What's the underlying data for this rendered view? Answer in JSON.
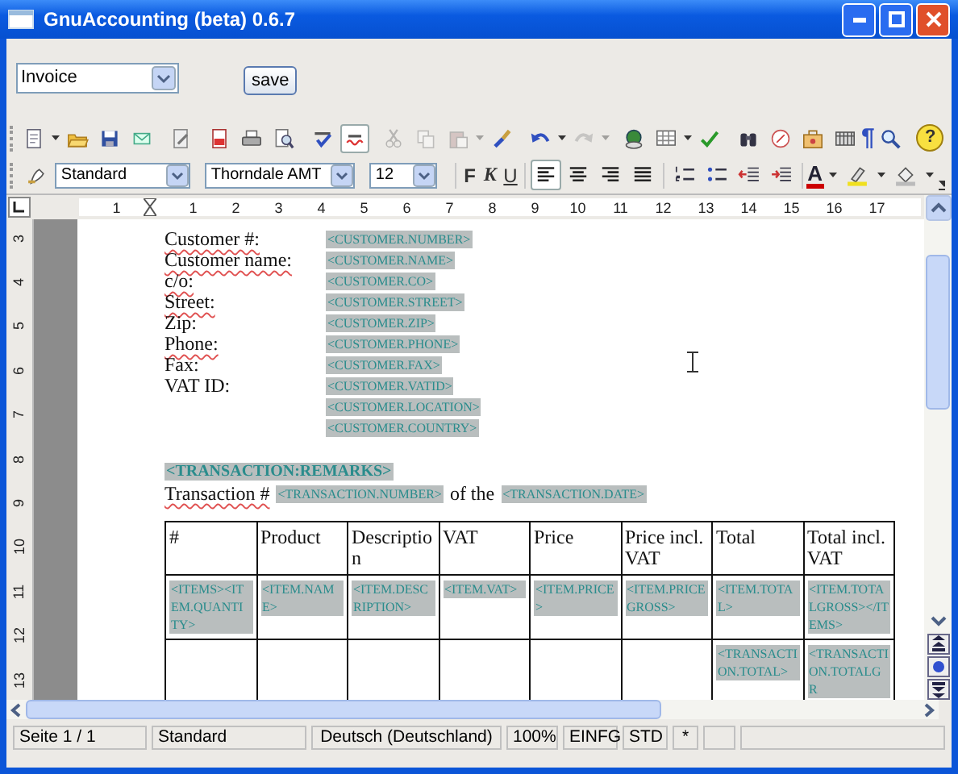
{
  "window": {
    "title": "GnuAccounting (beta) 0.6.7"
  },
  "form": {
    "document_type": "Invoice",
    "save_label": "save"
  },
  "toolbar": {
    "pilcrow": "¶",
    "help": "?",
    "disabled": {
      "cut": true,
      "copy": true,
      "paste": true,
      "redo": true
    },
    "autospellcheck_on": true
  },
  "format_bar": {
    "paragraph_style": "Standard",
    "font_name": "Thorndale AMT",
    "font_size": "12",
    "bold": "F",
    "italic": "K",
    "underline": "U",
    "font_color": "A",
    "alignment": [
      {
        "selected": true
      },
      {
        "selected": false
      },
      {
        "selected": false
      },
      {
        "selected": false
      }
    ]
  },
  "ruler": {
    "horizontal": [
      "1",
      "1",
      "2",
      "3",
      "4",
      "5",
      "6",
      "7",
      "8",
      "9",
      "10",
      "11",
      "12",
      "13",
      "14",
      "15",
      "16",
      "17"
    ],
    "vertical": [
      "3",
      "4",
      "5",
      "6",
      "7",
      "8",
      "9",
      "10",
      "11",
      "12",
      "13"
    ]
  },
  "customer_fields": [
    {
      "label": "Customer #:",
      "misspelled": true,
      "value": "<CUSTOMER.NUMBER>"
    },
    {
      "label": "Customer name:",
      "misspelled": true,
      "value": "<CUSTOMER.NAME>"
    },
    {
      "label": "c/o:",
      "misspelled": true,
      "value": "<CUSTOMER.CO>"
    },
    {
      "label": "Street:",
      "misspelled": true,
      "value": "<CUSTOMER.STREET>"
    },
    {
      "label": "Zip:",
      "misspelled": false,
      "value": "<CUSTOMER.ZIP>"
    },
    {
      "label": "Phone:",
      "misspelled": true,
      "value": "<CUSTOMER.PHONE>"
    },
    {
      "label": "Fax:",
      "misspelled": false,
      "value": "<CUSTOMER.FAX>"
    },
    {
      "label": "VAT ID:",
      "misspelled": false,
      "value": "<CUSTOMER.VATID>"
    },
    {
      "value": "<CUSTOMER.LOCATION>"
    },
    {
      "value": "<CUSTOMER.COUNTRY>"
    }
  ],
  "remarks": "<TRANSACTION:REMARKS>",
  "transaction_line": {
    "prefix": "Transaction #",
    "number": "<TRANSACTION.NUMBER>",
    "middle": "of the",
    "date": "<TRANSACTION.DATE>"
  },
  "table": {
    "columns": [
      "#",
      "Product",
      "Description",
      "VAT",
      "Price",
      "Price incl. VAT",
      "Total",
      "Total incl. VAT"
    ],
    "rows": [
      [
        "<ITEMS><ITEM.QUANTITY>",
        "<ITEM.NAME>",
        "<ITEM.DESCRIPTION>",
        "<ITEM.VAT>",
        "<ITEM.PRICE>",
        "<ITEM.PRICEGROSS>",
        "<ITEM.TOTAL>",
        "<ITEM.TOTALGROSS></ITEMS>"
      ],
      [
        "",
        "",
        "",
        "",
        "",
        "",
        "<TRANSACTION.TOTAL>",
        "<TRANSACTION.TOTALGR"
      ]
    ]
  },
  "status_bar": [
    "Seite 1 / 1",
    "Standard",
    "Deutsch (Deutschland)",
    "100%",
    "EINFG",
    "STD",
    "*"
  ]
}
